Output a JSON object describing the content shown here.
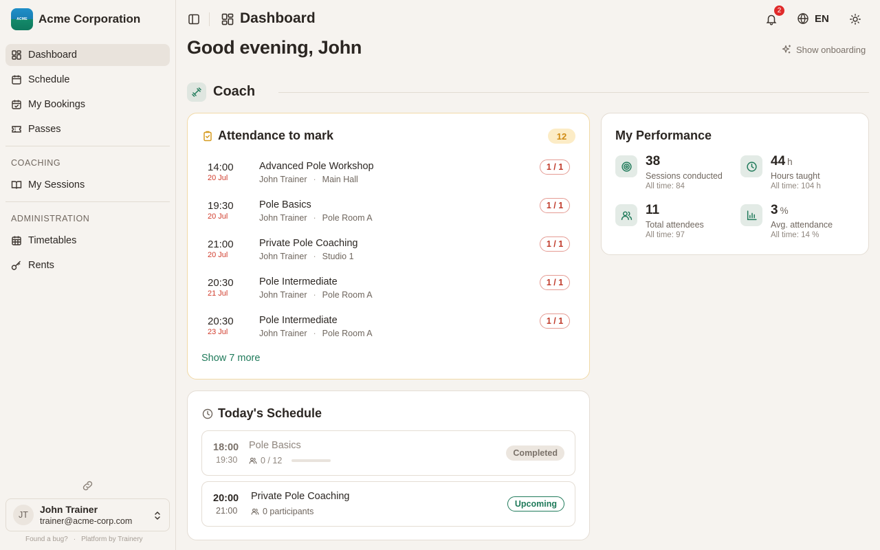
{
  "brand": {
    "name": "Acme Corporation",
    "logo_text": "ACME"
  },
  "sidebar": {
    "main": [
      {
        "label": "Dashboard",
        "icon": "dashboard-icon",
        "active": true
      },
      {
        "label": "Schedule",
        "icon": "calendar-icon"
      },
      {
        "label": "My Bookings",
        "icon": "calendar-check-icon"
      },
      {
        "label": "Passes",
        "icon": "ticket-icon"
      }
    ],
    "coaching_title": "COACHING",
    "coaching": [
      {
        "label": "My Sessions",
        "icon": "book-icon"
      }
    ],
    "admin_title": "ADMINISTRATION",
    "admin": [
      {
        "label": "Timetables",
        "icon": "calendar-grid-icon"
      },
      {
        "label": "Rents",
        "icon": "key-icon"
      }
    ],
    "user": {
      "initials": "JT",
      "name": "John Trainer",
      "email": "trainer@acme-corp.com"
    },
    "footer": {
      "bug": "Found a bug?",
      "sep": "·",
      "platform": "Platform by Trainery"
    }
  },
  "header": {
    "title": "Dashboard",
    "notifications": "2",
    "language": "EN"
  },
  "greeting": "Good evening, John",
  "onboarding": "Show onboarding",
  "section": {
    "title": "Coach"
  },
  "attendance": {
    "title": "Attendance to mark",
    "count": "12",
    "rows": [
      {
        "time": "14:00",
        "date": "20 Jul",
        "name": "Advanced Pole Workshop",
        "trainer": "John Trainer",
        "room": "Main Hall",
        "ratio": "1 / 1"
      },
      {
        "time": "19:30",
        "date": "20 Jul",
        "name": "Pole Basics",
        "trainer": "John Trainer",
        "room": "Pole Room A",
        "ratio": "1 / 1"
      },
      {
        "time": "21:00",
        "date": "20 Jul",
        "name": "Private Pole Coaching",
        "trainer": "John Trainer",
        "room": "Studio 1",
        "ratio": "1 / 1"
      },
      {
        "time": "20:30",
        "date": "21 Jul",
        "name": "Pole Intermediate",
        "trainer": "John Trainer",
        "room": "Pole Room A",
        "ratio": "1 / 1"
      },
      {
        "time": "20:30",
        "date": "23 Jul",
        "name": "Pole Intermediate",
        "trainer": "John Trainer",
        "room": "Pole Room A",
        "ratio": "1 / 1"
      }
    ],
    "dot": "·",
    "show_more": "Show 7 more"
  },
  "performance": {
    "title": "My Performance",
    "stats": [
      {
        "value": "38",
        "unit": "",
        "label": "Sessions conducted",
        "sub": "All time: 84",
        "icon": "target-icon"
      },
      {
        "value": "44",
        "unit": "h",
        "label": "Hours taught",
        "sub": "All time: 104 h",
        "icon": "clock-icon"
      },
      {
        "value": "11",
        "unit": "",
        "label": "Total attendees",
        "sub": "All time: 97",
        "icon": "users-icon"
      },
      {
        "value": "3",
        "unit": "%",
        "label": "Avg. attendance",
        "sub": "All time: 14 %",
        "icon": "bar-chart-icon"
      }
    ]
  },
  "schedule": {
    "title": "Today's Schedule",
    "items": [
      {
        "start": "18:00",
        "end": "19:30",
        "name": "Pole Basics",
        "meta": "0 / 12",
        "fill": 0.0,
        "status": "Completed"
      },
      {
        "start": "20:00",
        "end": "21:00",
        "name": "Private Pole Coaching",
        "meta": "0 participants",
        "status": "Upcoming"
      }
    ]
  },
  "colors": {
    "accent": "#1f7a5a",
    "warning": "#d08a12",
    "danger": "#c03a2a",
    "background": "#f6f3ef"
  }
}
